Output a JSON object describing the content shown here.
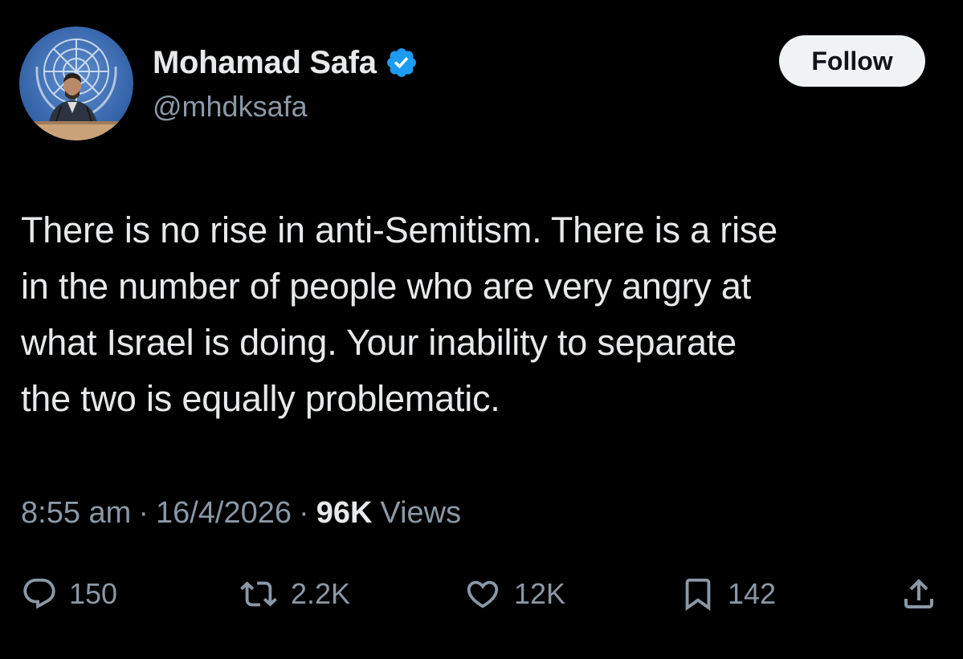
{
  "author": {
    "display_name": "Mohamad Safa",
    "handle": "@mhdksafa",
    "verified": true,
    "avatar_icon": "avatar-un-emblem-portrait"
  },
  "follow_label": "Follow",
  "tweet": {
    "text_lines": [
      "There is no rise in anti-Semitism. There is a rise",
      "in the number of people who are very angry at",
      "what Israel is doing. Your inability to separate",
      "the two is equally problematic."
    ]
  },
  "meta": {
    "time": "8:55 am",
    "separator": "·",
    "date": "16/4/2026",
    "views_count": "96K",
    "views_label": "Views"
  },
  "actions": {
    "replies": "150",
    "reposts": "2.2K",
    "likes": "12K",
    "bookmarks": "142"
  },
  "colors": {
    "background": "#000000",
    "primary_text": "#e7e9ea",
    "secondary_text": "#8b98a5",
    "verified_badge": "#1d9bf0",
    "follow_button_bg": "#eff3f4"
  }
}
